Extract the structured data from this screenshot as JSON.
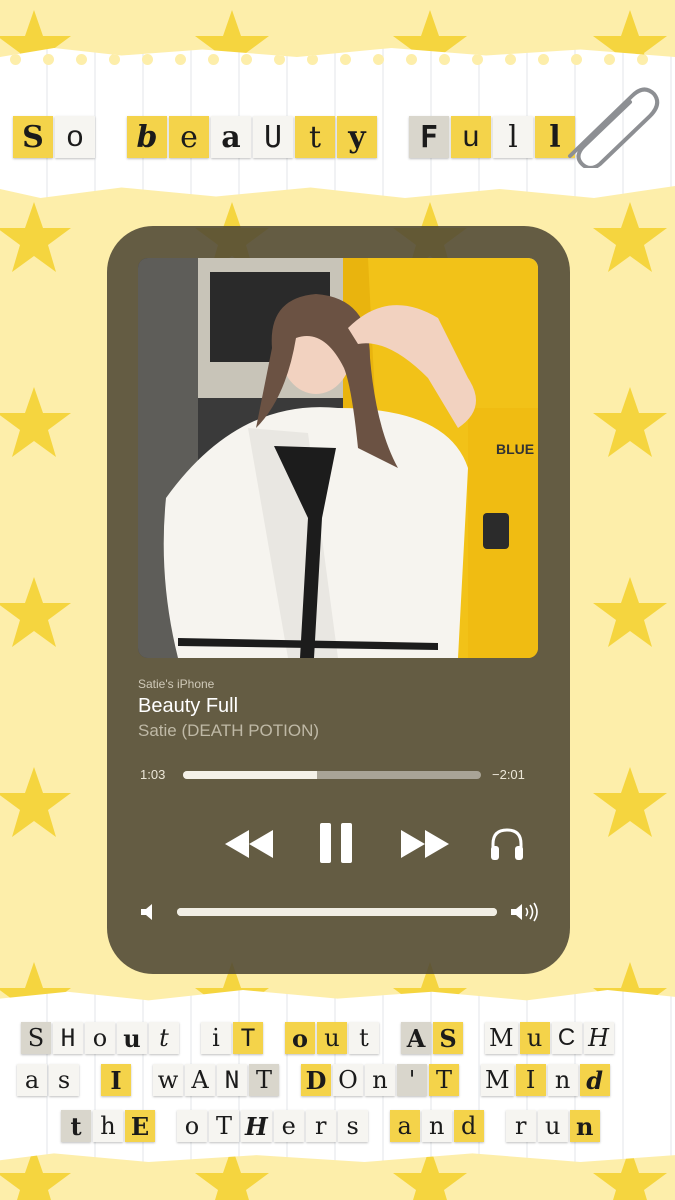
{
  "header": {
    "title_words": [
      [
        {
          "c": "S",
          "s": "y b"
        },
        {
          "c": "o",
          "s": "w s"
        }
      ],
      [
        {
          "c": "b",
          "s": "y b i"
        },
        {
          "c": "e",
          "s": "y"
        },
        {
          "c": "a",
          "s": "w b"
        },
        {
          "c": "U",
          "s": "w m"
        },
        {
          "c": "t",
          "s": "y"
        },
        {
          "c": "y",
          "s": "y b"
        }
      ],
      [
        {
          "c": "F",
          "s": "g b m"
        },
        {
          "c": "u",
          "s": "y s"
        },
        {
          "c": "l",
          "s": "w"
        },
        {
          "c": "l",
          "s": "y b"
        }
      ]
    ]
  },
  "player": {
    "device": "Satie's iPhone",
    "song_title": "Beauty Full",
    "artist": "Satie (DEATH POTION)",
    "elapsed": "1:03",
    "remaining": "−2:01",
    "progress_fraction": 0.45,
    "volume_fraction": 1.0,
    "icons": {
      "rewind": "rewind-icon",
      "pause": "pause-icon",
      "forward": "fast-forward-icon",
      "output": "headphones-icon",
      "vol_low": "volume-low-icon",
      "vol_high": "volume-high-icon"
    }
  },
  "footer": {
    "lines": [
      [
        [
          {
            "c": "S",
            "s": "g"
          },
          {
            "c": "H",
            "s": "w m"
          },
          {
            "c": "o",
            "s": "w"
          },
          {
            "c": "u",
            "s": "w b"
          },
          {
            "c": "t",
            "s": "w i"
          }
        ],
        [
          {
            "c": "i",
            "s": "w"
          },
          {
            "c": "T",
            "s": "y m"
          }
        ],
        [
          {
            "c": "o",
            "s": "y b"
          },
          {
            "c": "u",
            "s": "y"
          },
          {
            "c": "t",
            "s": "w"
          }
        ],
        [
          {
            "c": "A",
            "s": "g b"
          },
          {
            "c": "S",
            "s": "y b"
          }
        ],
        [
          {
            "c": "M",
            "s": "w"
          },
          {
            "c": "u",
            "s": "y"
          },
          {
            "c": "C",
            "s": "w s"
          },
          {
            "c": "H",
            "s": "w i"
          }
        ]
      ],
      [
        [
          {
            "c": "a",
            "s": "w"
          },
          {
            "c": "s",
            "s": "w"
          }
        ],
        [
          {
            "c": "I",
            "s": "y b"
          }
        ],
        [
          {
            "c": "w",
            "s": "w"
          },
          {
            "c": "A",
            "s": "w"
          },
          {
            "c": "N",
            "s": "w m"
          },
          {
            "c": "T",
            "s": "g"
          }
        ],
        [
          {
            "c": "D",
            "s": "y b"
          },
          {
            "c": "O",
            "s": "w"
          },
          {
            "c": "n",
            "s": "w"
          },
          {
            "c": "'",
            "s": "g"
          },
          {
            "c": "T",
            "s": "y"
          }
        ],
        [
          {
            "c": "M",
            "s": "w"
          },
          {
            "c": "I",
            "s": "y"
          },
          {
            "c": "n",
            "s": "w"
          },
          {
            "c": "d",
            "s": "y b i"
          }
        ]
      ],
      [
        [
          {
            "c": "t",
            "s": "g b"
          },
          {
            "c": "h",
            "s": "w"
          },
          {
            "c": "E",
            "s": "y b"
          }
        ],
        [
          {
            "c": "o",
            "s": "w"
          },
          {
            "c": "T",
            "s": "w"
          },
          {
            "c": "H",
            "s": "w b i"
          },
          {
            "c": "e",
            "s": "w"
          },
          {
            "c": "r",
            "s": "w"
          },
          {
            "c": "s",
            "s": "w"
          }
        ],
        [
          {
            "c": "a",
            "s": "y"
          },
          {
            "c": "n",
            "s": "w"
          },
          {
            "c": "d",
            "s": "y"
          }
        ],
        [
          {
            "c": "r",
            "s": "w"
          },
          {
            "c": "u",
            "s": "w"
          },
          {
            "c": "n",
            "s": "y b"
          }
        ]
      ]
    ]
  },
  "colors": {
    "background": "#fdeeaa",
    "star": "#f5d53f",
    "player_bg": "#4e4834",
    "accent_yellow": "#f4d34a"
  }
}
